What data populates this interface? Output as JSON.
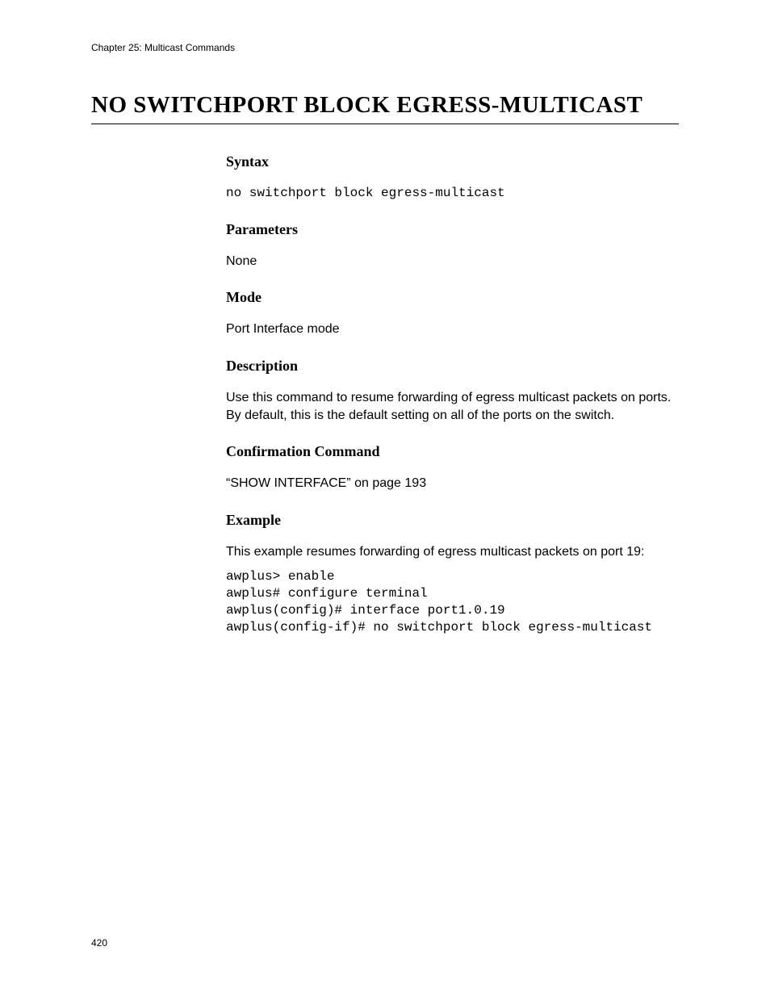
{
  "header": {
    "chapter": "Chapter 25: Multicast Commands"
  },
  "title": "NO SWITCHPORT BLOCK EGRESS-MULTICAST",
  "sections": {
    "syntax": {
      "heading": "Syntax",
      "code": "no switchport block egress-multicast"
    },
    "parameters": {
      "heading": "Parameters",
      "text": "None"
    },
    "mode": {
      "heading": "Mode",
      "text": "Port Interface mode"
    },
    "description": {
      "heading": "Description",
      "text": "Use this command to resume forwarding of egress multicast packets on ports. By default, this is the default setting on all of the ports on the switch."
    },
    "confirmation": {
      "heading": "Confirmation Command",
      "text": "“SHOW INTERFACE” on page 193"
    },
    "example": {
      "heading": "Example",
      "intro": "This example resumes forwarding of egress multicast packets on port 19:",
      "code": "awplus> enable\nawplus# configure terminal\nawplus(config)# interface port1.0.19\nawplus(config-if)# no switchport block egress-multicast"
    }
  },
  "page_number": "420"
}
